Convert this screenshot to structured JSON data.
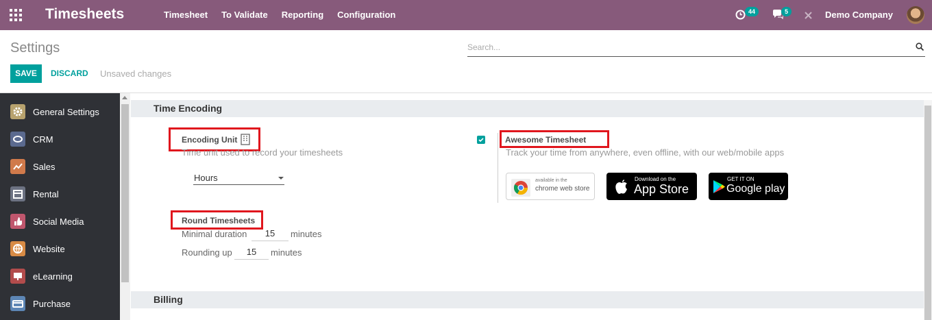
{
  "navbar": {
    "brand": "Timesheets",
    "menu": [
      "Timesheet",
      "To Validate",
      "Reporting",
      "Configuration"
    ],
    "activity_count": "44",
    "message_count": "5",
    "company": "Demo Company"
  },
  "control_panel": {
    "title": "Settings",
    "search_placeholder": "Search...",
    "save_label": "SAVE",
    "discard_label": "DISCARD",
    "status": "Unsaved changes"
  },
  "sidebar": {
    "items": [
      {
        "label": "General Settings",
        "icon": "gear-icon",
        "color": "#b7a26e"
      },
      {
        "label": "CRM",
        "icon": "handshake-icon",
        "color": "#5b6a8f"
      },
      {
        "label": "Sales",
        "icon": "chart-icon",
        "color": "#d07a4b"
      },
      {
        "label": "Rental",
        "icon": "calendar-icon",
        "color": "#6c7282"
      },
      {
        "label": "Social Media",
        "icon": "thumbs-up-icon",
        "color": "#c0566d"
      },
      {
        "label": "Website",
        "icon": "globe-icon",
        "color": "#d88b45"
      },
      {
        "label": "eLearning",
        "icon": "presentation-icon",
        "color": "#b24c4c"
      },
      {
        "label": "Purchase",
        "icon": "credit-card-icon",
        "color": "#5d86b5"
      }
    ]
  },
  "sections": {
    "time_encoding": "Time Encoding",
    "billing": "Billing"
  },
  "encoding_unit": {
    "title": "Encoding Unit",
    "description": "Time unit used to record your timesheets",
    "selected": "Hours"
  },
  "round_timesheets": {
    "title": "Round Timesheets",
    "minimal_label": "Minimal duration",
    "minimal_value": "15",
    "rounding_label": "Rounding up",
    "rounding_value": "15",
    "unit": "minutes"
  },
  "awesome_timesheet": {
    "title": "Awesome Timesheet",
    "description": "Track your time from anywhere, even offline, with our web/mobile apps",
    "checked": true
  },
  "stores": {
    "chrome_small": "available in the",
    "chrome_big": "chrome web store",
    "apple_small": "Download on the",
    "apple_big": "App Store",
    "google_small": "GET IT ON",
    "google_big": "Google play"
  },
  "colors": {
    "navbar": "#875a7b",
    "accent": "#00a09d",
    "highlight": "#e0161d"
  }
}
